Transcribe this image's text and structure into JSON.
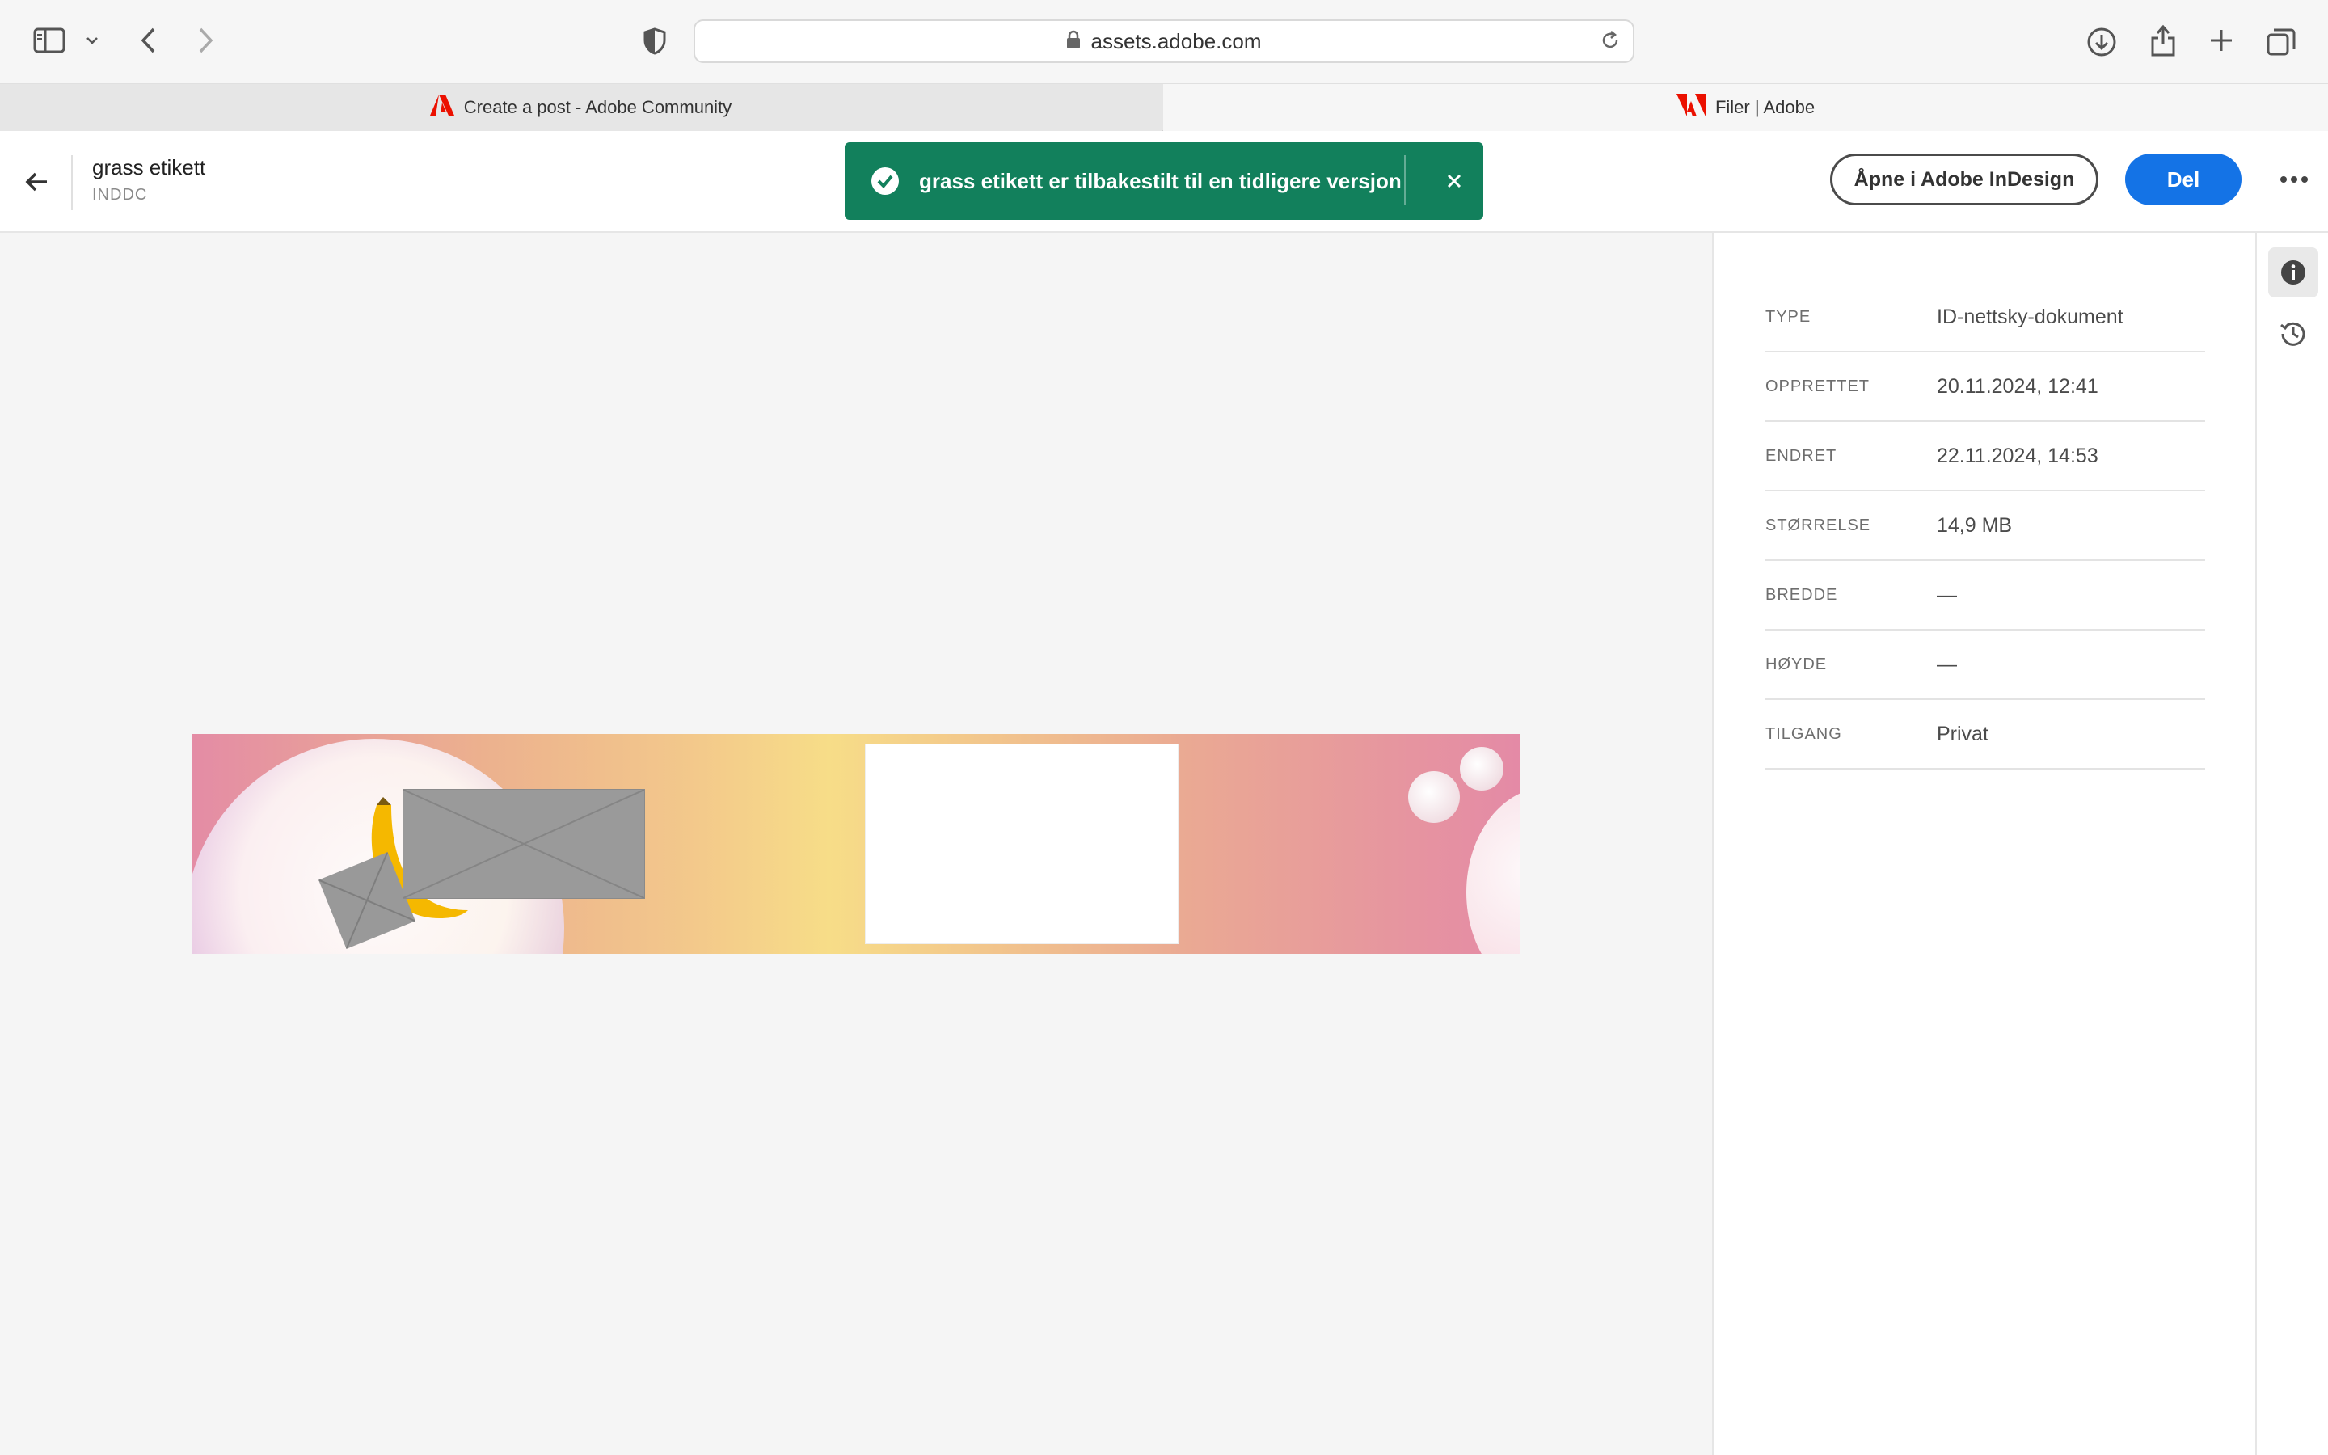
{
  "browser": {
    "url": "assets.adobe.com",
    "tabs": [
      {
        "title": "Create a post - Adobe Community",
        "active": false
      },
      {
        "title": "Filer | Adobe",
        "active": true
      }
    ]
  },
  "header": {
    "doc_title": "grass etikett",
    "doc_type": "INDDC",
    "open_button_label": "Åpne i Adobe InDesign",
    "share_button_label": "Del"
  },
  "toast": {
    "message": "grass etikett er tilbakestilt til en tidligere versjon",
    "color": "#12805c"
  },
  "info": [
    {
      "key": "TYPE",
      "value": "ID-nettsky-dokument"
    },
    {
      "key": "OPPRETTET",
      "value": "20.11.2024, 12:41"
    },
    {
      "key": "ENDRET",
      "value": "22.11.2024, 14:53"
    },
    {
      "key": "STØRRELSE",
      "value": "14,9 MB"
    },
    {
      "key": "BREDDE",
      "value": "—"
    },
    {
      "key": "HØYDE",
      "value": "—"
    },
    {
      "key": "TILGANG",
      "value": "Privat"
    }
  ],
  "colors": {
    "accent": "#1473e6",
    "adobe_red": "#eb1000"
  }
}
